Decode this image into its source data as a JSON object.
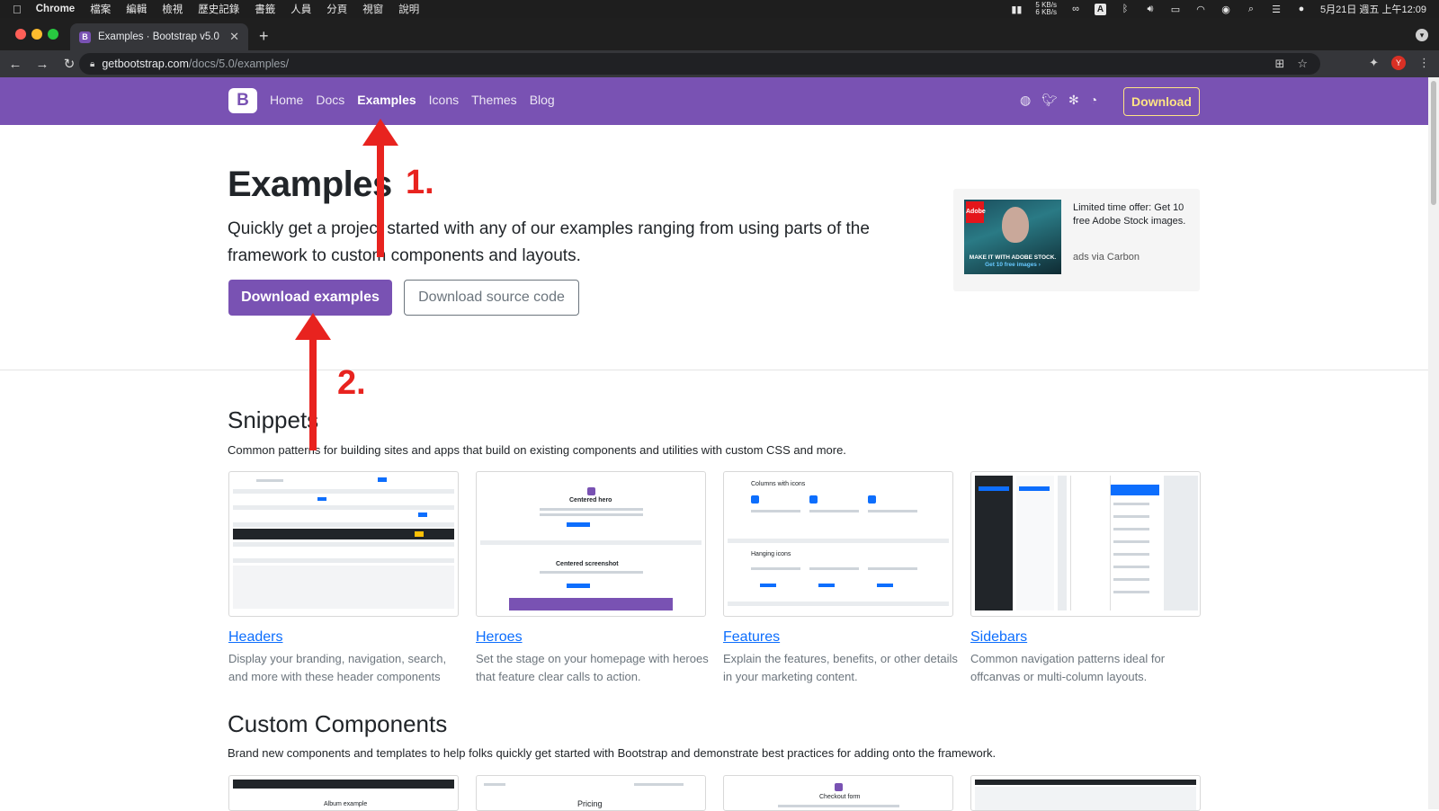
{
  "menubar": {
    "items": [
      "Chrome",
      "檔案",
      "編輯",
      "檢視",
      "歷史記錄",
      "書籤",
      "人員",
      "分頁",
      "視窗",
      "說明"
    ],
    "net_up": "5 KB/s",
    "net_down": "6 KB/s",
    "ime": "A",
    "clock": "5月21日 週五 上午12:09"
  },
  "browser": {
    "tab_title": "Examples · Bootstrap v5.0",
    "favicon_letter": "B",
    "url_host": "getbootstrap.com",
    "url_path": "/docs/5.0/examples/",
    "profile_letter": "Y"
  },
  "navbar": {
    "brand": "B",
    "links": [
      "Home",
      "Docs",
      "Examples",
      "Icons",
      "Themes",
      "Blog"
    ],
    "active_link": "Examples",
    "download": "Download"
  },
  "hero": {
    "title": "Examples",
    "lead": "Quickly get a project started with any of our examples ranging from using parts of the framework to custom components and layouts.",
    "primary_button": "Download examples",
    "secondary_button": "Download source code"
  },
  "ad": {
    "logo": "Adobe",
    "caption_line1": "MAKE IT WITH ADOBE STOCK.",
    "caption_line2": "Get 10 free images ›",
    "text": "Limited time offer: Get 10 free Adobe Stock images.",
    "via": "ads via Carbon"
  },
  "snippets": {
    "title": "Snippets",
    "description": "Common patterns for building sites and apps that build on existing components and utilities with custom CSS and more.",
    "cards": [
      {
        "title": "Headers",
        "description": "Display your branding, navigation, search, and more with these header components"
      },
      {
        "title": "Heroes",
        "description": "Set the stage on your homepage with heroes that feature clear calls to action."
      },
      {
        "title": "Features",
        "description": "Explain the features, benefits, or other details in your marketing content."
      },
      {
        "title": "Sidebars",
        "description": "Common navigation patterns ideal for offcanvas or multi-column layouts."
      }
    ],
    "thumb_labels": {
      "heroes_top": "Centered hero",
      "heroes_bottom": "Centered screenshot",
      "features_top": "Columns with icons",
      "features_bottom": "Hanging icons"
    }
  },
  "custom": {
    "title": "Custom Components",
    "description": "Brand new components and templates to help folks quickly get started with Bootstrap and demonstrate best practices for adding onto the framework.",
    "thumb_labels": [
      "Album example",
      "Pricing",
      "Checkout form",
      ""
    ]
  },
  "annotations": {
    "step1": "1.",
    "step2": "2.",
    "color": "#e8231f"
  },
  "colors": {
    "brand_purple": "#7952b3",
    "download_yellow": "#ffe484",
    "link_blue": "#0d6efd"
  }
}
